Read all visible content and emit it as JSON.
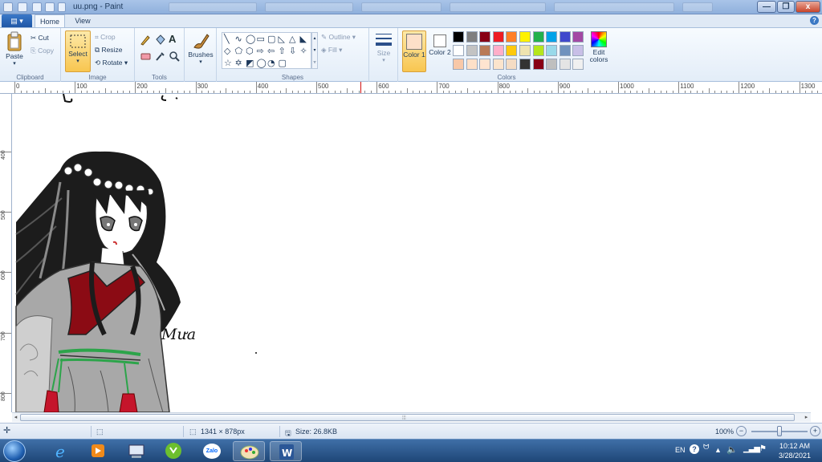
{
  "window": {
    "title": "uu.png - Paint",
    "minimize": "—",
    "maximize": "❐",
    "close": "x"
  },
  "ribbon_tabs": {
    "file": "▤ ▾",
    "home": "Home",
    "view": "View",
    "help": "?"
  },
  "clipboard": {
    "paste": "Paste",
    "cut": "Cut",
    "copy": "Copy",
    "label": "Clipboard"
  },
  "image": {
    "select": "Select",
    "crop": "Crop",
    "resize": "Resize",
    "rotate": "Rotate ▾",
    "label": "Image"
  },
  "tools": {
    "label": "Tools",
    "text_tool": "A"
  },
  "brushes": {
    "label": "Brushes"
  },
  "shapes": {
    "label": "Shapes",
    "outline": "Outline ▾",
    "fill": "Fill ▾",
    "glyphs": [
      "╲",
      "∿",
      "◯",
      "▭",
      "▢",
      "◺",
      "△",
      "◣",
      "◇",
      "⬠",
      "⬡",
      "⇨",
      "⇦",
      "⇧",
      "⇩",
      "✧",
      "☆",
      "✡",
      "◩",
      "◯",
      "◔",
      "▢"
    ]
  },
  "size": {
    "label": "Size"
  },
  "colors": {
    "label": "Colors",
    "color1": "Color 1",
    "color2": "Color 2",
    "edit": "Edit colors",
    "palette_row1": [
      "#000000",
      "#7f7f7f",
      "#880015",
      "#ed1c24",
      "#ff7f27",
      "#fff200",
      "#22b14c",
      "#00a2e8",
      "#3f48cc",
      "#a349a4"
    ],
    "palette_row2": [
      "#ffffff",
      "#c3c3c3",
      "#b97a57",
      "#ffaec9",
      "#ffc90e",
      "#efe4b0",
      "#b5e61d",
      "#99d9ea",
      "#7092be",
      "#c8bfe7"
    ],
    "palette_row3": [
      "#f8c8a8",
      "#fde0c8",
      "#ffe4d0",
      "#fbe4cc",
      "#f4dcc4",
      "#333333",
      "#880015",
      "#bfbfbf",
      "#e4e4e4",
      "#f0f0f0"
    ]
  },
  "ruler": {
    "h_labels": [
      "0",
      "100",
      "200",
      "300",
      "400",
      "500",
      "600",
      "700",
      "800",
      "900",
      "1000",
      "1100",
      "1200",
      "1300"
    ],
    "v_labels": [
      "400",
      "500",
      "600",
      "700",
      "800"
    ]
  },
  "canvas": {
    "handwritten_text": "Mưa"
  },
  "status": {
    "dimensions": "1341 × 878px",
    "size": "Size: 26.8KB",
    "zoom": "100%",
    "zoom_out": "−",
    "zoom_in": "+"
  },
  "taskbar": {
    "tray_lang": "EN",
    "time": "10:12 AM",
    "date": "3/28/2021",
    "zalo": "Zalo"
  }
}
